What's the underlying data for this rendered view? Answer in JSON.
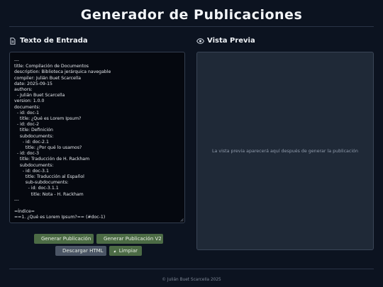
{
  "header": {
    "title": "Generador de Publicaciones"
  },
  "input_panel": {
    "title": "Texto de Entrada",
    "icon": "file-icon",
    "content": "---\ntitle: Compilación de Documentos\ndescription: Biblioteca jerárquica navegable\ncompiler: Julián Buet Scarcella\ndate: 2025-09-15\nauthors:\n  - Julián Buet Scarcella\nversion: 1.0.0\ndocuments:\n  - id: doc-1\n    title: ¿Qué es Lorem Ipsum?\n  - id: doc-2\n    title: Definición\n    subdocuments:\n      - id: doc-2.1\n        title: ¿Por qué lo usamos?\n  - id: doc-3\n    title: Traducción de H. Rackham\n    subdocuments:\n      - id: doc-3.1\n        title: Traducción al Español\n        sub-subdocuments:\n          - id: doc-3.1.1\n            title: Nota - H. Rackham\n---\n\n=Índice=\n==1. ¿Qué es Lorem Ipsum?== (#doc-1)"
  },
  "preview_panel": {
    "title": "Vista Previa",
    "icon": "eye-icon",
    "placeholder": "La vista previa aparecerá aquí después de generar la publicación"
  },
  "buttons": {
    "generate": "Generar Publicación",
    "generate_v2": "Generar Publicación V2",
    "download": "Descargar HTML",
    "clear": "Limpiar"
  },
  "footer": {
    "text": "© Julián Buet Scarcella 2025"
  },
  "colors": {
    "background": "#0c1320",
    "green_button": "#4c6b45",
    "gray_button": "#4b5565",
    "preview_bg": "#1f2937"
  }
}
